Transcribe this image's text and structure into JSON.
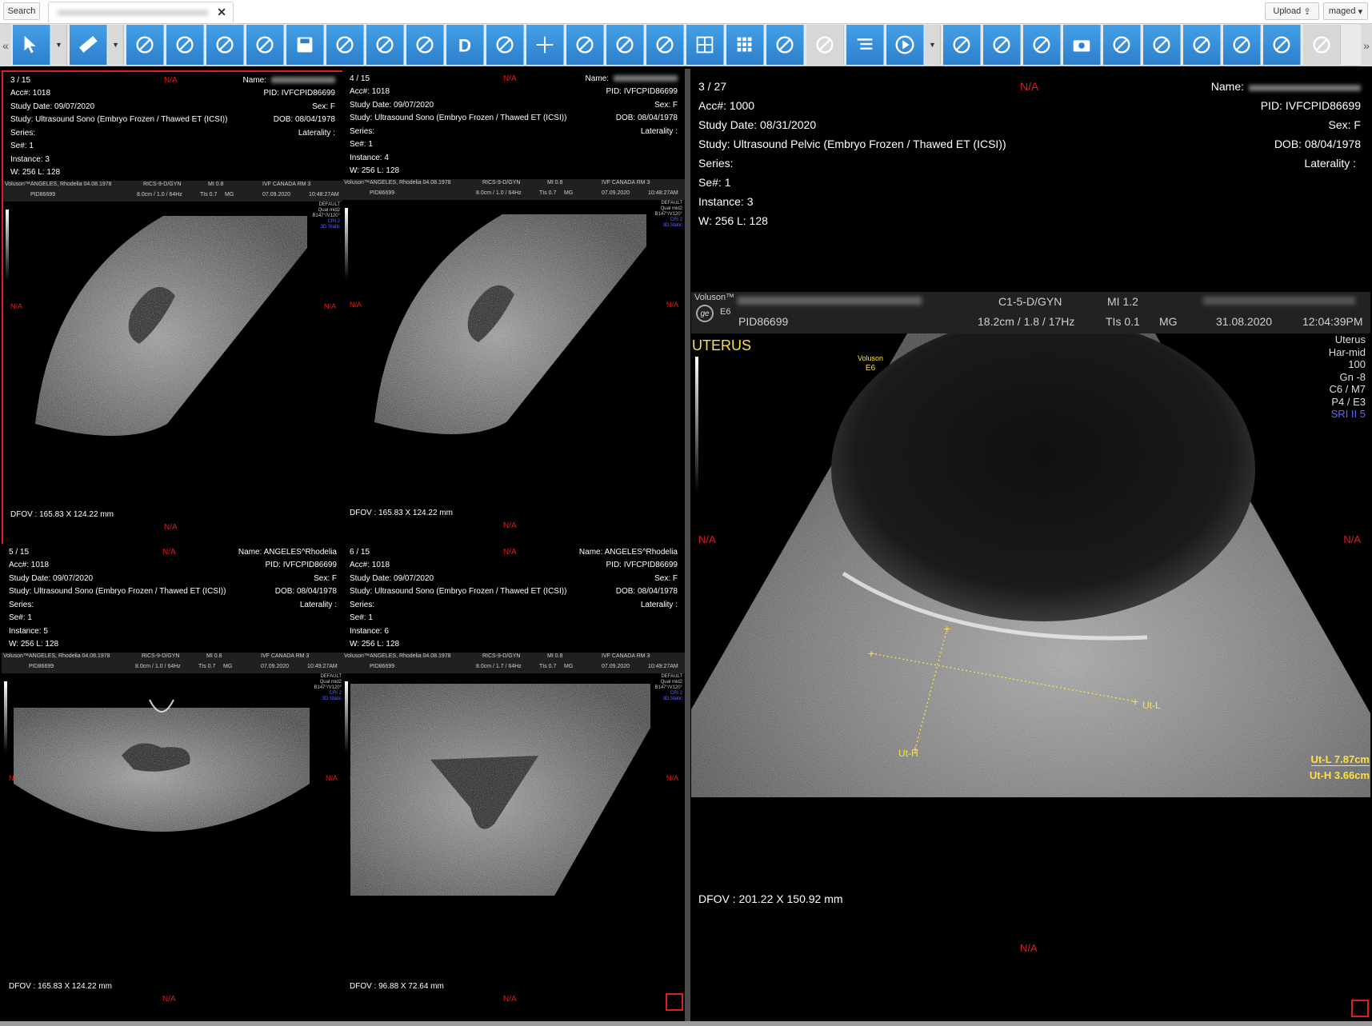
{
  "topbar": {
    "search_label": "Search",
    "upload_label": "Upload",
    "user_label": "maged"
  },
  "toolbar": {
    "tools": [
      "pointer-icon",
      "ruler-icon",
      "annotate-icon",
      "cross-cut-icon",
      "scissors-icon",
      "brush-icon",
      "save-icon",
      "folder-open-icon",
      "refresh-icon",
      "report-icon",
      "d-letter-icon",
      "link-icon",
      "crosshair-icon",
      "person-icon",
      "body-icon",
      "cut-icon",
      "layout-2x2-icon",
      "layout-3x3-icon",
      "save-grid-icon",
      "clear-layout-icon",
      "list-icon",
      "play-icon",
      "save-series-icon",
      "download-icon",
      "folder-icon",
      "camera-icon",
      "volume-icon",
      "document-icon",
      "settings-3d-icon",
      "pipette-icon",
      "gear-3d-icon",
      "grid-icon"
    ]
  },
  "viewports": [
    {
      "index": "3 / 15",
      "acc": "Acc#: 1018",
      "study_date": "Study Date: 09/07/2020",
      "study": "Study: Ultrasound Sono (Embryo Frozen / Thawed ET (ICSI))",
      "series": "Series:",
      "se": "Se#: 1",
      "instance": "Instance: 3",
      "wl": "W: 256 L: 128",
      "name": "Name:",
      "pid": "PID: IVFCPID86699",
      "sex": "Sex: F",
      "dob": "DOB: 08/04/1978",
      "laterality": "Laterality :",
      "na": "N/A",
      "dfov": "DFOV : 165.83 X 124.22 mm",
      "bar1": [
        "ANGELES, Rhodelia 04.08.1978",
        "RICS-9-D/GYN",
        "MI 0.8",
        "IVF CANADA RM 3"
      ],
      "bar2": [
        "PID86699",
        "8.0cm / 1.0 / 64Hz",
        "TIs 0.7",
        "MG",
        "07.09.2020",
        "10:48:27AM"
      ],
      "side": [
        "DEFAULT",
        "Qual mid2",
        "B147°/V120°",
        "CRI 2",
        "3D Static"
      ]
    },
    {
      "index": "4 / 15",
      "acc": "Acc#: 1018",
      "study_date": "Study Date: 09/07/2020",
      "study": "Study: Ultrasound Sono (Embryo Frozen / Thawed ET (ICSI))",
      "series": "Series:",
      "se": "Se#: 1",
      "instance": "Instance: 4",
      "wl": "W: 256 L: 128",
      "name": "Name:",
      "pid": "PID: IVFCPID86699",
      "sex": "Sex: F",
      "dob": "DOB: 08/04/1978",
      "laterality": "Laterality :",
      "na": "N/A",
      "dfov": "DFOV : 165.83 X 124.22 mm",
      "bar1": [
        "ANGELES, Rhodelia 04.08.1978",
        "RICS-9-D/GYN",
        "MI 0.8",
        "IVF CANADA RM 3"
      ],
      "bar2": [
        "PID86699",
        "8.0cm / 1.0 / 64Hz",
        "TIs 0.7",
        "MG",
        "07.09.2020",
        "10:48:27AM"
      ],
      "side": [
        "DEFAULT",
        "Qual mid2",
        "B147°/V120°",
        "CRI 2",
        "3D Static"
      ]
    },
    {
      "index": "5 / 15",
      "acc": "Acc#: 1018",
      "study_date": "Study Date: 09/07/2020",
      "study": "Study: Ultrasound Sono (Embryo Frozen / Thawed ET (ICSI))",
      "series": "Series:",
      "se": "Se#: 1",
      "instance": "Instance: 5",
      "wl": "W: 256 L: 128",
      "name": "Name: ANGELES^Rhodelia",
      "pid": "PID: IVFCPID86699",
      "sex": "Sex: F",
      "dob": "DOB: 08/04/1978",
      "laterality": "Laterality :",
      "na": "N/A",
      "dfov": "DFOV : 165.83 X 124.22 mm",
      "bar1": [
        "ANGELES, Rhodelia 04.08.1978",
        "RICS-9-D/GYN",
        "MI 0.8",
        "IVF CANADA RM 3"
      ],
      "bar2": [
        "PID86699",
        "8.0cm / 1.0 / 64Hz",
        "TIs 0.7",
        "MG",
        "07.09.2020",
        "10:49:27AM"
      ],
      "side": [
        "DEFAULT",
        "Qual mid2",
        "B147°/V120°",
        "CRI 2",
        "3D Static"
      ]
    },
    {
      "index": "6 / 15",
      "acc": "Acc#: 1018",
      "study_date": "Study Date: 09/07/2020",
      "study": "Study: Ultrasound Sono (Embryo Frozen / Thawed ET (ICSI))",
      "series": "Series:",
      "se": "Se#: 1",
      "instance": "Instance: 6",
      "wl": "W: 256 L: 128",
      "name": "Name: ANGELES^Rhodelia",
      "pid": "PID: IVFCPID86699",
      "sex": "Sex: F",
      "dob": "DOB: 08/04/1978",
      "laterality": "Laterality :",
      "na": "N/A",
      "dfov": "DFOV : 96.88 X 72.64 mm",
      "bar1": [
        "ANGELES, Rhodelia 04.08.1978",
        "RICS-9-D/GYN",
        "MI 0.8",
        "IVF CANADA RM 3"
      ],
      "bar2": [
        "PID86699",
        "8.0cm / 1.7 / 64Hz",
        "TIs 0.7",
        "MG",
        "07.09.2020",
        "10:49:27AM"
      ],
      "side": [
        "DEFAULT",
        "Qual mid2",
        "B147°/V120°",
        "CRI 2",
        "3D Static"
      ]
    }
  ],
  "main_view": {
    "index": "3 / 27",
    "acc": "Acc#: 1000",
    "study_date": "Study Date: 08/31/2020",
    "study": "Study: Ultrasound Pelvic (Embryo Frozen / Thawed ET (ICSI))",
    "series": "Series:",
    "se": "Se#: 1",
    "instance": "Instance: 3",
    "wl": "W: 256 L: 128",
    "name": "Name:",
    "pid": "PID: IVFCPID86699",
    "sex": "Sex: F",
    "dob": "DOB: 08/04/1978",
    "laterality": "Laterality :",
    "na": "N/A",
    "dfov": "DFOV : 201.22 X 150.92 mm",
    "brand": "Voluson™",
    "model": "E6",
    "probe": "C1-5-D/GYN",
    "mi": "MI 1.2",
    "pid_bar": "PID86699",
    "depth": "18.2cm / 1.8 / 17Hz",
    "tis": "TIs 0.1",
    "mg": "MG",
    "date": "31.08.2020",
    "time": "12:04:39PM",
    "organ": "UTERUS",
    "logo_small": [
      "Voluson",
      "E6"
    ],
    "params": [
      "Uterus",
      "Har-mid",
      "100",
      "Gn  -8",
      "C6 / M7",
      "P4 / E3"
    ],
    "sri": "SRI II 5",
    "cal_label_l": "Ut-L",
    "cal_label_h": "Ut-H",
    "measure_l": "Ut-L  7.87cm",
    "measure_h": "Ut-H  3.66cm"
  },
  "colors": {
    "accent": "#2c7fcc",
    "selection": "#e21d1d",
    "measure": "#ffe23d",
    "sri": "#5b69ff"
  }
}
